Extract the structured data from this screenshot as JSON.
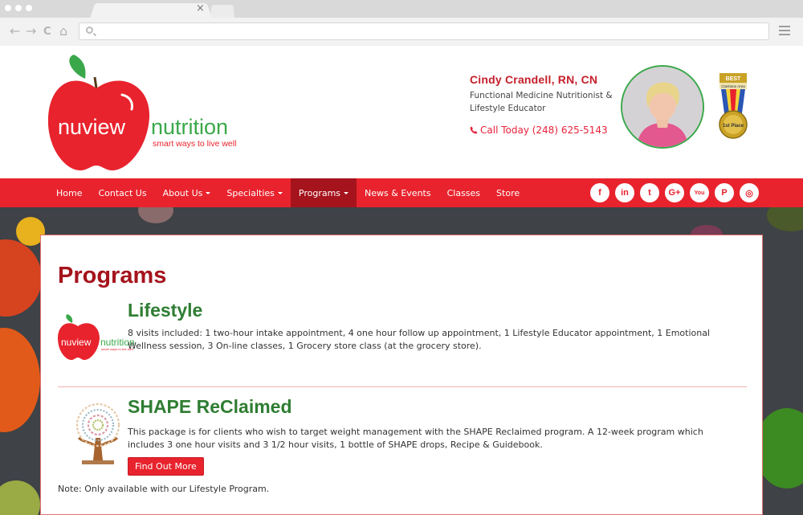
{
  "browser": {
    "tab_close": "×",
    "nav_back": "←",
    "nav_forward": "→",
    "nav_reload": "C",
    "nav_home": "⌂"
  },
  "header": {
    "logo_word1": "nuview",
    "logo_word2": "nutrition",
    "logo_tagline": "smart ways to live well",
    "contact_name": "Cindy Crandell, RN, CN",
    "contact_title_line1": "Functional Medicine Nutritionist &",
    "contact_title_line2": "Lifestyle Educator",
    "phone_text": "Call Today (248) 625-5143",
    "medal_top": "BEST",
    "medal_region": "Clarkston Area",
    "medal_place": "1st Place"
  },
  "nav": {
    "items": [
      {
        "label": "Home",
        "dropdown": false,
        "active": false
      },
      {
        "label": "Contact Us",
        "dropdown": false,
        "active": false
      },
      {
        "label": "About Us",
        "dropdown": true,
        "active": false
      },
      {
        "label": "Specialties",
        "dropdown": true,
        "active": false
      },
      {
        "label": "Programs",
        "dropdown": true,
        "active": true
      },
      {
        "label": "News & Events",
        "dropdown": false,
        "active": false
      },
      {
        "label": "Classes",
        "dropdown": false,
        "active": false
      },
      {
        "label": "Store",
        "dropdown": false,
        "active": false
      }
    ],
    "socials": [
      {
        "icon": "facebook-icon",
        "glyph": "f"
      },
      {
        "icon": "linkedin-icon",
        "glyph": "in"
      },
      {
        "icon": "twitter-icon",
        "glyph": "t"
      },
      {
        "icon": "google-plus-icon",
        "glyph": "G+"
      },
      {
        "icon": "youtube-icon",
        "glyph": "You"
      },
      {
        "icon": "pinterest-icon",
        "glyph": "P"
      },
      {
        "icon": "instagram-icon",
        "glyph": "◎"
      }
    ]
  },
  "main": {
    "page_title": "Programs",
    "programs": [
      {
        "title": "Lifestyle",
        "description": "8 visits included: 1 two-hour intake appointment, 4 one hour follow up appointment, 1 Lifestyle Educator appointment, 1 Emotional Wellness session, 3 On-line classes, 1 Grocery store class (at the grocery store).",
        "thumb_word1": "nuview",
        "thumb_word2": "nutrition",
        "thumb_tagline": "smart ways to live well"
      },
      {
        "title": "SHAPE ReClaimed",
        "description": "This package is for clients who wish to target weight management with the SHAPE Reclaimed program. A 12-week program which includes 3 one hour visits and 3 1/2 hour visits, 1 bottle of SHAPE drops, Recipe & Guidebook.",
        "button_label": "Find Out More"
      }
    ],
    "note": "Note: Only available with our Lifestyle Program."
  },
  "colors": {
    "brand_red": "#e8232d",
    "dark_red": "#a5131c",
    "brand_green": "#2e7d32"
  }
}
